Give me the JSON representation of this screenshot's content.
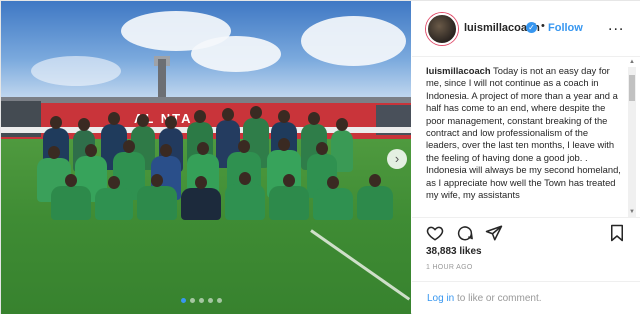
{
  "post": {
    "username": "luismillacoach",
    "verified_icon": "verified-badge-icon",
    "separator": "•",
    "follow_label": "Follow",
    "more_label": "...",
    "caption_user": "luismillacoach",
    "caption_text": "Today is not an easy day for me, since I will not continue as a coach in Indonesia. A project of more than a year and a half has come to an end, where despite the poor management, constant breaking of the contract and low professionalism of the leaders, over the last ten months, I leave with the feeling of having done a good job. . Indonesia will always be my second homeland, as I appreciate how well the Town has treated my wife, my assistants",
    "likes": "38,883 likes",
    "time": "1 HOUR AGO",
    "login_link": "Log in",
    "login_rest": " to like or comment."
  },
  "photo": {
    "stadium_sign": "AL   NTA",
    "next_icon": "chevron-right-icon",
    "slide_count": 5,
    "active_slide": 1
  },
  "colors": {
    "accent": "#3897f0",
    "text": "#262626",
    "muted": "#999999",
    "border": "#efefef"
  },
  "icons": [
    "heart-icon",
    "comment-icon",
    "share-icon",
    "bookmark-icon"
  ]
}
